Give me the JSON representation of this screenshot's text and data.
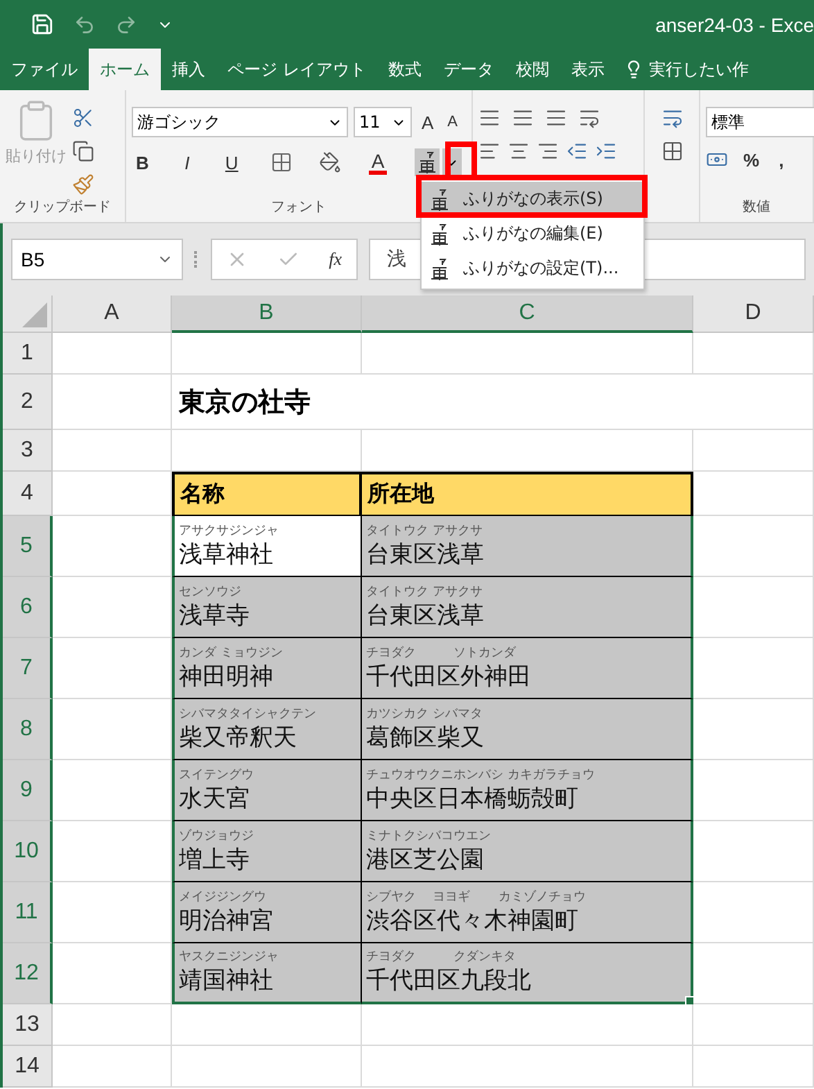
{
  "window": {
    "title": "anser24-03  -  Exce"
  },
  "tabs": [
    {
      "label": "ファイル",
      "selected": false
    },
    {
      "label": "ホーム",
      "selected": true
    },
    {
      "label": "挿入",
      "selected": false
    },
    {
      "label": "ページ レイアウト",
      "selected": false
    },
    {
      "label": "数式",
      "selected": false
    },
    {
      "label": "データ",
      "selected": false
    },
    {
      "label": "校閲",
      "selected": false
    },
    {
      "label": "表示",
      "selected": false
    }
  ],
  "tell_me": "実行したい作",
  "ribbon": {
    "clipboard": {
      "paste_label": "貼り付け",
      "group_label": "クリップボード"
    },
    "font": {
      "font_name": "游ゴシック",
      "font_size": "11",
      "grow": "A",
      "shrink": "A",
      "bold": "B",
      "italic": "I",
      "underline": "U",
      "font_color": "A",
      "group_label": "フォント"
    },
    "number": {
      "format": "標準",
      "percent": "%",
      "comma": ",",
      "group_label": "数値"
    }
  },
  "furigana_menu": {
    "items": [
      {
        "label": "ふりがなの表示(S)",
        "selected": true
      },
      {
        "label": "ふりがなの編集(E)",
        "selected": false
      },
      {
        "label": "ふりがなの設定(T)...",
        "selected": false
      }
    ]
  },
  "formula_bar": {
    "name_box": "B5",
    "fx": "fx",
    "value": "浅"
  },
  "sheet": {
    "columns": [
      {
        "label": "A",
        "selected": false
      },
      {
        "label": "B",
        "selected": true
      },
      {
        "label": "C",
        "selected": true
      },
      {
        "label": "D",
        "selected": false
      }
    ],
    "rows": [
      {
        "number": "1",
        "selected": false,
        "kind": "blank"
      },
      {
        "number": "2",
        "selected": false,
        "kind": "title",
        "text": "東京の社寺"
      },
      {
        "number": "3",
        "selected": false,
        "kind": "blank"
      },
      {
        "number": "4",
        "selected": false,
        "kind": "header",
        "cells": [
          "名称",
          "所在地"
        ]
      },
      {
        "number": "5",
        "selected": true,
        "kind": "entry",
        "cells": [
          {
            "furigana": "アサクサジンジャ",
            "text": "浅草神社",
            "highlighted": false
          },
          {
            "furigana": "タイトウク アサクサ",
            "text": "台東区浅草",
            "highlighted": true
          }
        ]
      },
      {
        "number": "6",
        "selected": true,
        "kind": "entry",
        "cells": [
          {
            "furigana": "センソウジ",
            "text": "浅草寺",
            "highlighted": true
          },
          {
            "furigana": "タイトウク アサクサ",
            "text": "台東区浅草",
            "highlighted": true
          }
        ]
      },
      {
        "number": "7",
        "selected": true,
        "kind": "entry",
        "cells": [
          {
            "furigana": "カンダ ミョウジン",
            "text": "神田明神",
            "highlighted": true
          },
          {
            "furigana": "チヨダク　　　ソトカンダ",
            "text": "千代田区外神田",
            "highlighted": true
          }
        ]
      },
      {
        "number": "8",
        "selected": true,
        "kind": "entry",
        "cells": [
          {
            "furigana": "シバマタタイシャクテン",
            "text": "柴又帝釈天",
            "highlighted": true
          },
          {
            "furigana": "カツシカク シバマタ",
            "text": "葛飾区柴又",
            "highlighted": true
          }
        ]
      },
      {
        "number": "9",
        "selected": true,
        "kind": "entry",
        "cells": [
          {
            "furigana": "スイテングウ",
            "text": "水天宮",
            "highlighted": true
          },
          {
            "furigana": "チュウオウクニホンバシ カキガラチョウ",
            "text": "中央区日本橋蛎殻町",
            "highlighted": true
          }
        ]
      },
      {
        "number": "10",
        "selected": true,
        "kind": "entry",
        "cells": [
          {
            "furigana": "ゾウジョウジ",
            "text": "増上寺",
            "highlighted": true
          },
          {
            "furigana": "ミナトクシバコウエン",
            "text": "港区芝公園",
            "highlighted": true
          }
        ]
      },
      {
        "number": "11",
        "selected": true,
        "kind": "entry",
        "cells": [
          {
            "furigana": "メイジジングウ",
            "text": "明治神宮",
            "highlighted": true
          },
          {
            "furigana": "シブヤク　 ヨヨギ　　 カミゾノチョウ",
            "text": "渋谷区代々木神園町",
            "highlighted": true
          }
        ]
      },
      {
        "number": "12",
        "selected": true,
        "kind": "entry",
        "cells": [
          {
            "furigana": "ヤスクニジンジャ",
            "text": "靖国神社",
            "highlighted": true
          },
          {
            "furigana": "チヨダク　　　クダンキタ",
            "text": "千代田区九段北",
            "highlighted": true
          }
        ]
      },
      {
        "number": "13",
        "selected": false,
        "kind": "blank"
      },
      {
        "number": "14",
        "selected": false,
        "kind": "blank"
      }
    ]
  }
}
